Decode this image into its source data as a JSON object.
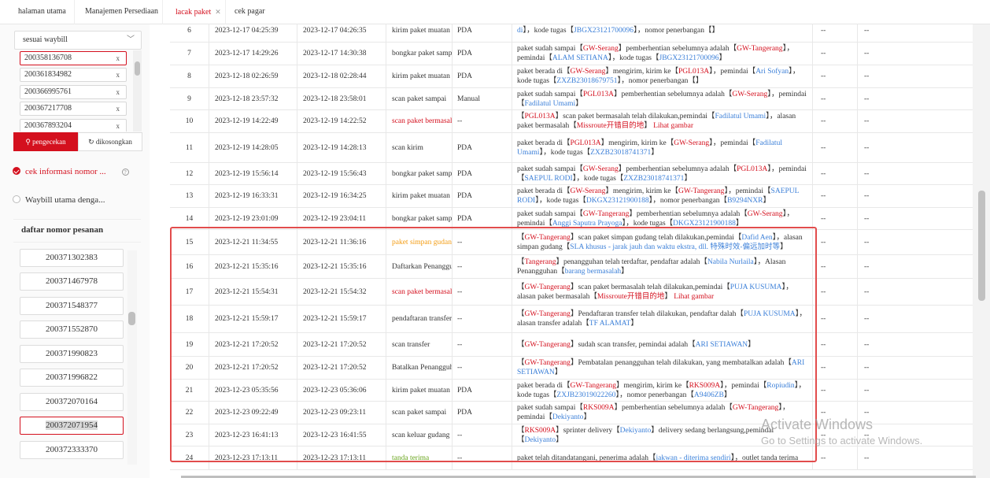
{
  "tabs": [
    {
      "label": "halaman utama",
      "active": false,
      "closable": false
    },
    {
      "label": "Manajemen Persediaan",
      "active": false,
      "closable": false
    },
    {
      "label": "lacak paket",
      "active": true,
      "closable": true
    },
    {
      "label": "cek pagar",
      "active": false,
      "closable": false
    }
  ],
  "sidebar": {
    "select_value": "sesuai waybill",
    "waybills": [
      "200358136708",
      "200361834982",
      "200366995761",
      "200367217708",
      "200367893204"
    ],
    "search_button": "pengecekan",
    "clear_button": "dikosongkan",
    "option_check": "cek informasi nomor ...",
    "option_main": "Waybill utama denga...",
    "order_list_title": "daftar nomor pesanan",
    "orders": [
      "200371302383",
      "200371467978",
      "200371548377",
      "200371552870",
      "200371990823",
      "200371996822",
      "200372070164",
      "200372071954",
      "200372333370"
    ],
    "selected_order": "200372071954"
  },
  "table": {
    "rows": [
      {
        "no": "6",
        "t1": "2023-12-17 04:25:39",
        "t2": "2023-12-17 04:26:35",
        "op": "kirim paket muatan",
        "op_color": "default",
        "dev": "PDA",
        "desc": [
          {
            "t": "di",
            "c": "blue"
          },
          {
            "t": "】，kode tugas【"
          },
          {
            "t": "JBGX23121700096",
            "c": "blue"
          },
          {
            "t": "】，nomor penerbangan【】"
          }
        ],
        "a": "--",
        "b": "--"
      },
      {
        "no": "7",
        "t1": "2023-12-17 14:29:26",
        "t2": "2023-12-17 14:30:38",
        "op": "bongkar paket sampai",
        "op_color": "default",
        "dev": "PDA",
        "desc": [
          {
            "t": "paket sudah sampai【"
          },
          {
            "t": "GW-Serang",
            "c": "red"
          },
          {
            "t": "】pemberhentian sebelumnya adalah【"
          },
          {
            "t": "GW-Tangerang",
            "c": "red"
          },
          {
            "t": "】，pemindai【"
          },
          {
            "t": "ALAM SETIANA",
            "c": "blue"
          },
          {
            "t": "】，kode tugas【"
          },
          {
            "t": "JBGX23121700096",
            "c": "blue"
          },
          {
            "t": "】"
          }
        ],
        "a": "--",
        "b": "--"
      },
      {
        "no": "8",
        "t1": "2023-12-18 02:26:59",
        "t2": "2023-12-18 02:28:44",
        "op": "kirim paket muatan",
        "op_color": "default",
        "dev": "PDA",
        "desc": [
          {
            "t": "paket berada di【"
          },
          {
            "t": "GW-Serang",
            "c": "red"
          },
          {
            "t": "】mengirim, kirim ke【"
          },
          {
            "t": "PGL013A",
            "c": "red"
          },
          {
            "t": "】，pemindai【"
          },
          {
            "t": "Ari Sofyan",
            "c": "blue"
          },
          {
            "t": "】，kode tugas【"
          },
          {
            "t": "ZXZB23018679751",
            "c": "blue"
          },
          {
            "t": "】，nomor penerbangan【】"
          }
        ],
        "a": "--",
        "b": "--"
      },
      {
        "no": "9",
        "t1": "2023-12-18 23:57:32",
        "t2": "2023-12-18 23:58:01",
        "op": "scan paket sampai",
        "op_color": "default",
        "dev": "Manual",
        "desc": [
          {
            "t": "paket sudah sampai【"
          },
          {
            "t": "PGL013A",
            "c": "red"
          },
          {
            "t": "】pemberhentian sebelumnya adalah【"
          },
          {
            "t": "GW-Serang",
            "c": "red"
          },
          {
            "t": "】，pemindai【"
          },
          {
            "t": "Fadilatul Umami",
            "c": "blue"
          },
          {
            "t": "】"
          }
        ],
        "a": "--",
        "b": "--"
      },
      {
        "no": "10",
        "t1": "2023-12-19 14:22:49",
        "t2": "2023-12-19 14:22:52",
        "op": "scan paket bermasalah",
        "op_color": "red",
        "dev": "--",
        "desc": [
          {
            "t": "【"
          },
          {
            "t": "PGL013A",
            "c": "red"
          },
          {
            "t": "】scan paket bermasalah telah dilakukan,pemindai【"
          },
          {
            "t": "Fadilatul Umami",
            "c": "blue"
          },
          {
            "t": "】，alasan paket bermasalah【"
          },
          {
            "t": "Missroute开错目的地",
            "c": "red"
          },
          {
            "t": "】 "
          },
          {
            "t": "Lihat gambar",
            "c": "red"
          }
        ],
        "a": "--",
        "b": "--"
      },
      {
        "no": "11",
        "t1": "2023-12-19 14:28:05",
        "t2": "2023-12-19 14:28:13",
        "op": "scan kirim",
        "op_color": "default",
        "dev": "PDA",
        "desc": [
          {
            "t": "paket berada di【"
          },
          {
            "t": "PGL013A",
            "c": "red"
          },
          {
            "t": "】mengirim, kirim ke【"
          },
          {
            "t": "GW-Serang",
            "c": "red"
          },
          {
            "t": "】，pemindai【"
          },
          {
            "t": "Fadilatul Umami",
            "c": "blue"
          },
          {
            "t": "】，kode tugas【"
          },
          {
            "t": "ZXZB23018741371",
            "c": "blue"
          },
          {
            "t": "】"
          }
        ],
        "a": "--",
        "b": "--"
      },
      {
        "no": "12",
        "t1": "2023-12-19 15:56:14",
        "t2": "2023-12-19 15:56:43",
        "op": "bongkar paket sampai",
        "op_color": "default",
        "dev": "PDA",
        "desc": [
          {
            "t": "paket sudah sampai【"
          },
          {
            "t": "GW-Serang",
            "c": "red"
          },
          {
            "t": "】pemberhentian sebelumnya adalah【"
          },
          {
            "t": "PGL013A",
            "c": "red"
          },
          {
            "t": "】，pemindai【"
          },
          {
            "t": "SAEPUL RODI",
            "c": "blue"
          },
          {
            "t": "】，kode tugas【"
          },
          {
            "t": "ZXZB23018741371",
            "c": "blue"
          },
          {
            "t": "】"
          }
        ],
        "a": "--",
        "b": "--"
      },
      {
        "no": "13",
        "t1": "2023-12-19 16:33:31",
        "t2": "2023-12-19 16:34:25",
        "op": "kirim paket muatan",
        "op_color": "default",
        "dev": "PDA",
        "desc": [
          {
            "t": "paket berada di【"
          },
          {
            "t": "GW-Serang",
            "c": "red"
          },
          {
            "t": "】mengirim, kirim ke【"
          },
          {
            "t": "GW-Tangerang",
            "c": "red"
          },
          {
            "t": "】，pemindai【"
          },
          {
            "t": "SAEPUL RODI",
            "c": "blue"
          },
          {
            "t": "】，kode tugas【"
          },
          {
            "t": "DKGX23121900188",
            "c": "blue"
          },
          {
            "t": "】，nomor penerbangan【"
          },
          {
            "t": "B9294NXR",
            "c": "blue"
          },
          {
            "t": "】"
          }
        ],
        "a": "--",
        "b": "--"
      },
      {
        "no": "14",
        "t1": "2023-12-19 23:01:09",
        "t2": "2023-12-19 23:04:11",
        "op": "bongkar paket sampai",
        "op_color": "default",
        "dev": "PDA",
        "desc": [
          {
            "t": "paket sudah sampai【"
          },
          {
            "t": "GW-Tangerang",
            "c": "red"
          },
          {
            "t": "】pemberhentian sebelumnya adalah【"
          },
          {
            "t": "GW-Serang",
            "c": "red"
          },
          {
            "t": "】，pemindai【"
          },
          {
            "t": "Anggi Saputra Prayoga",
            "c": "blue"
          },
          {
            "t": "】，kode tugas【"
          },
          {
            "t": "DKGX23121900188",
            "c": "blue"
          },
          {
            "t": "】"
          }
        ],
        "a": "--",
        "b": "--"
      },
      {
        "no": "15",
        "t1": "2023-12-21 11:34:55",
        "t2": "2023-12-21 11:36:16",
        "op": "paket simpan gudang",
        "op_color": "orange",
        "dev": "--",
        "desc": [
          {
            "t": "【"
          },
          {
            "t": "GW-Tangerang",
            "c": "red"
          },
          {
            "t": "】scan paket simpan gudang telah dilakukan,pemindai【"
          },
          {
            "t": "Dafid Aen",
            "c": "blue"
          },
          {
            "t": "】，alasan simpan gudang【"
          },
          {
            "t": "SLA khusus - jarak jauh dan waktu ekstra, dll. 特殊时效-偏远加时等",
            "c": "blue"
          },
          {
            "t": "】"
          }
        ],
        "a": "--",
        "b": "--"
      },
      {
        "no": "16",
        "t1": "2023-12-21 15:35:16",
        "t2": "2023-12-21 15:35:16",
        "op": "Daftarkan Penangguhan",
        "op_color": "default",
        "dev": "--",
        "desc": [
          {
            "t": "【"
          },
          {
            "t": "Tangerang",
            "c": "red"
          },
          {
            "t": "】penangguhan telah terdaftar, pendaftar adalah【"
          },
          {
            "t": "Nabila Nurlaila",
            "c": "blue"
          },
          {
            "t": "】，Alasan Penangguhan【"
          },
          {
            "t": "barang bermasalah",
            "c": "blue"
          },
          {
            "t": "】"
          }
        ],
        "a": "--",
        "b": "--"
      },
      {
        "no": "17",
        "t1": "2023-12-21 15:54:31",
        "t2": "2023-12-21 15:54:32",
        "op": "scan paket bermasalah",
        "op_color": "red",
        "dev": "--",
        "desc": [
          {
            "t": "【"
          },
          {
            "t": "GW-Tangerang",
            "c": "red"
          },
          {
            "t": "】scan paket bermasalah telah dilakukan,pemindai【"
          },
          {
            "t": "PUJA KUSUMA",
            "c": "blue"
          },
          {
            "t": "】，alasan paket bermasalah【"
          },
          {
            "t": "Missroute开错目的地",
            "c": "red"
          },
          {
            "t": "】 "
          },
          {
            "t": "Lihat gambar",
            "c": "red"
          }
        ],
        "a": "--",
        "b": "--"
      },
      {
        "no": "18",
        "t1": "2023-12-21 15:59:17",
        "t2": "2023-12-21 15:59:17",
        "op": "pendaftaran transfer",
        "op_color": "default",
        "dev": "--",
        "desc": [
          {
            "t": "【"
          },
          {
            "t": "GW-Tangerang",
            "c": "red"
          },
          {
            "t": "】Pendaftaran transfer telah dilakukan, pendaftar dalah【"
          },
          {
            "t": "PUJA KUSUMA",
            "c": "blue"
          },
          {
            "t": "】，alasan transfer adalah【"
          },
          {
            "t": "TF ALAMAT",
            "c": "blue"
          },
          {
            "t": "】"
          }
        ],
        "a": "--",
        "b": "--"
      },
      {
        "no": "19",
        "t1": "2023-12-21 17:20:52",
        "t2": "2023-12-21 17:20:52",
        "op": "scan transfer",
        "op_color": "default",
        "dev": "--",
        "desc": [
          {
            "t": "【"
          },
          {
            "t": "GW-Tangerang",
            "c": "red"
          },
          {
            "t": "】sudah scan transfer, pemindai adalah【"
          },
          {
            "t": "ARI SETIAWAN",
            "c": "blue"
          },
          {
            "t": "】"
          }
        ],
        "a": "--",
        "b": "--"
      },
      {
        "no": "20",
        "t1": "2023-12-21 17:20:52",
        "t2": "2023-12-21 17:20:52",
        "op": "Batalkan Penangguhan",
        "op_color": "default",
        "dev": "--",
        "desc": [
          {
            "t": "【"
          },
          {
            "t": "GW-Tangerang",
            "c": "red"
          },
          {
            "t": "】Pembatalan penangguhan telah dilakukan, yang membatalkan adalah【"
          },
          {
            "t": "ARI SETIAWAN",
            "c": "blue"
          },
          {
            "t": "】"
          }
        ],
        "a": "--",
        "b": "--"
      },
      {
        "no": "21",
        "t1": "2023-12-23 05:35:56",
        "t2": "2023-12-23 05:36:06",
        "op": "kirim paket muatan",
        "op_color": "default",
        "dev": "PDA",
        "desc": [
          {
            "t": "paket berada di【"
          },
          {
            "t": "GW-Tangerang",
            "c": "red"
          },
          {
            "t": "】mengirim, kirim ke【"
          },
          {
            "t": "RKS009A",
            "c": "red"
          },
          {
            "t": "】，pemindai【"
          },
          {
            "t": "Ropiudin",
            "c": "blue"
          },
          {
            "t": "】，kode tugas【"
          },
          {
            "t": "ZXJB23019022260",
            "c": "blue"
          },
          {
            "t": "】，nomor penerbangan【"
          },
          {
            "t": "A9406ZB",
            "c": "blue"
          },
          {
            "t": "】"
          }
        ],
        "a": "--",
        "b": "--"
      },
      {
        "no": "22",
        "t1": "2023-12-23 09:22:49",
        "t2": "2023-12-23 09:23:11",
        "op": "scan paket sampai",
        "op_color": "default",
        "dev": "PDA",
        "desc": [
          {
            "t": "paket sudah sampai【"
          },
          {
            "t": "RKS009A",
            "c": "red"
          },
          {
            "t": "】pemberhentian sebelumnya adalah【"
          },
          {
            "t": "GW-Tangerang",
            "c": "red"
          },
          {
            "t": "】，pemindai【"
          },
          {
            "t": "Dekiyanto",
            "c": "blue"
          },
          {
            "t": "】"
          }
        ],
        "a": "--",
        "b": "--"
      },
      {
        "no": "23",
        "t1": "2023-12-23 16:41:13",
        "t2": "2023-12-23 16:41:55",
        "op": "scan keluar gudang",
        "op_color": "default",
        "dev": "--",
        "desc": [
          {
            "t": "【"
          },
          {
            "t": "RKS009A",
            "c": "red"
          },
          {
            "t": "】sprinter delivery【"
          },
          {
            "t": "Dekiyanto",
            "c": "blue"
          },
          {
            "t": "】delivery sedang berlangsung,pemindai【"
          },
          {
            "t": "Dekiyanto",
            "c": "blue"
          },
          {
            "t": "】"
          }
        ],
        "a": "--",
        "b": "--"
      },
      {
        "no": "24",
        "t1": "2023-12-23 17:13:11",
        "t2": "2023-12-23 17:13:11",
        "op": "tanda terima",
        "op_color": "green",
        "dev": "--",
        "desc": [
          {
            "t": "paket telah ditandatangani, penerima adalah【"
          },
          {
            "t": "jakwan - diterima sendiri",
            "c": "blue"
          },
          {
            "t": "】，outlet tanda terima"
          }
        ],
        "a": "--",
        "b": "--"
      }
    ]
  },
  "watermark": {
    "line1": "Activate Windows",
    "line2": "Go to Settings to activate Windows."
  },
  "colors": {
    "accent": "#d4101e",
    "link": "#3b7fd8",
    "warning": "#f39c12",
    "success": "#6aa31c",
    "highlight_box": "#e24c4c"
  }
}
